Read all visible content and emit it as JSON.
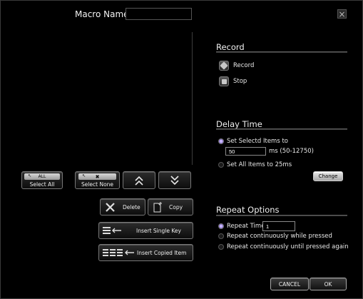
{
  "header": {
    "macro_name_label": "Macro Name",
    "macro_name_value": ""
  },
  "close_label": "×",
  "record": {
    "title": "Record",
    "record_label": "Record",
    "stop_label": "Stop"
  },
  "list_buttons": {
    "select_all_tag": "ALL",
    "select_all_label": "Select All",
    "select_none_label": "Select None",
    "move_up_glyph": "︽",
    "move_down_glyph": "︾"
  },
  "edit_buttons": {
    "delete_label": "Delete",
    "copy_label": "Copy",
    "insert_single_label": "Insert Single Key",
    "insert_copied_label": "Insert Copied Item"
  },
  "delay": {
    "title": "Delay Time",
    "set_selected_label": "Set Selectd Items to",
    "ms_value": "50",
    "ms_range_label": "ms (50-12750)",
    "set_all_label": "Set All Items to 25ms",
    "change_label": "Change"
  },
  "repeat": {
    "title": "Repeat Options",
    "repeat_times_label": "Repeat Times",
    "repeat_times_value": "1",
    "while_pressed_label": "Repeat continuously while pressed",
    "until_pressed_label": "Repeat continuously until pressed again"
  },
  "footer": {
    "cancel_label": "CANCEL",
    "ok_label": "OK"
  }
}
